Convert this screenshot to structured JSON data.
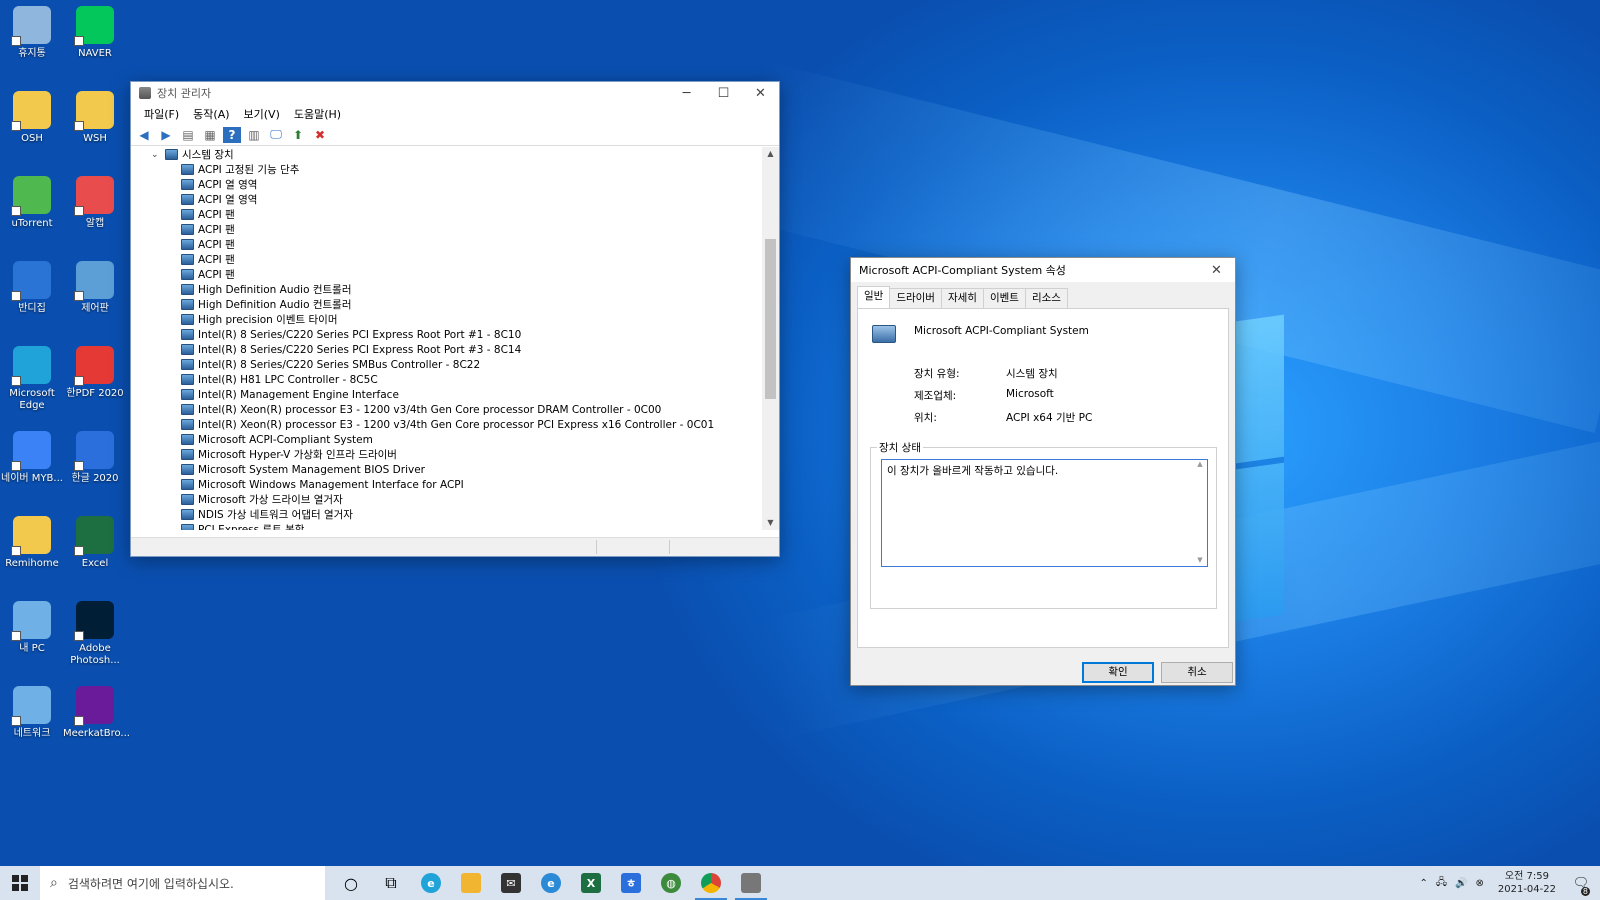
{
  "desktop": {
    "icons": [
      {
        "label": "휴지통",
        "icon": "recycle-bin-icon",
        "color": "#8fb7dd"
      },
      {
        "label": "NAVER",
        "icon": "naver-icon",
        "color": "#03c75a"
      },
      {
        "label": "OSH",
        "icon": "folder-icon",
        "color": "#f2c94c"
      },
      {
        "label": "WSH",
        "icon": "folder-icon",
        "color": "#f2c94c"
      },
      {
        "label": "uTorrent",
        "icon": "utorrent-icon",
        "color": "#4fb84f"
      },
      {
        "label": "알캡",
        "icon": "alcapture-icon",
        "color": "#e84c4c"
      },
      {
        "label": "반디집",
        "icon": "bandizip-icon",
        "color": "#2a74d6"
      },
      {
        "label": "제어판",
        "icon": "control-panel-icon",
        "color": "#5c9fd6"
      },
      {
        "label": "Microsoft Edge",
        "icon": "edge-icon",
        "color": "#1fa3d8"
      },
      {
        "label": "한PDF 2020",
        "icon": "hanpdf-icon",
        "color": "#e53935"
      },
      {
        "label": "네이버 MYB...",
        "icon": "naver-myb-icon",
        "color": "#3b82f6"
      },
      {
        "label": "한글 2020",
        "icon": "hangul-icon",
        "color": "#2a6fdb"
      },
      {
        "label": "Remihome",
        "icon": "remihome-icon",
        "color": "#f2c94c"
      },
      {
        "label": "Excel",
        "icon": "excel-icon",
        "color": "#1d6f42"
      },
      {
        "label": "내 PC",
        "icon": "this-pc-icon",
        "color": "#6fb0e6"
      },
      {
        "label": "Adobe Photosh...",
        "icon": "photoshop-icon",
        "color": "#001e36"
      },
      {
        "label": "네트워크",
        "icon": "network-icon",
        "color": "#6fb0e6"
      },
      {
        "label": "MeerkatBro...",
        "icon": "meerkat-icon",
        "color": "#6a1b9a"
      }
    ]
  },
  "devmgr": {
    "title": "장치 관리자",
    "menu": [
      "파일(F)",
      "동작(A)",
      "보기(V)",
      "도움말(H)"
    ],
    "category": "시스템 장치",
    "devices": [
      "ACPI 고정된 기능 단추",
      "ACPI 열 영역",
      "ACPI 열 영역",
      "ACPI 팬",
      "ACPI 팬",
      "ACPI 팬",
      "ACPI 팬",
      "ACPI 팬",
      "High Definition Audio 컨트롤러",
      "High Definition Audio 컨트롤러",
      "High precision 이벤트 타이머",
      "Intel(R) 8 Series/C220 Series PCI Express Root Port #1 - 8C10",
      "Intel(R) 8 Series/C220 Series PCI Express Root Port #3 - 8C14",
      "Intel(R) 8 Series/C220 Series SMBus Controller - 8C22",
      "Intel(R) H81 LPC Controller - 8C5C",
      "Intel(R) Management Engine Interface",
      "Intel(R) Xeon(R) processor E3 - 1200 v3/4th Gen Core processor DRAM Controller - 0C00",
      "Intel(R) Xeon(R) processor E3 - 1200 v3/4th Gen Core processor PCI Express x16 Controller - 0C01",
      "Microsoft ACPI-Compliant System",
      "Microsoft Hyper-V 가상화 인프라 드라이버",
      "Microsoft System Management BIOS Driver",
      "Microsoft Windows Management Interface for ACPI",
      "Microsoft 가상 드라이브 열거자",
      "NDIS 가상 네트워크 어댑터 열거자",
      "PCI Express 루트 복합"
    ]
  },
  "props": {
    "title": "Microsoft ACPI-Compliant System 속성",
    "tabs": [
      "일반",
      "드라이버",
      "자세히",
      "이벤트",
      "리소스"
    ],
    "device_name": "Microsoft ACPI-Compliant System",
    "type_label": "장치 유형:",
    "type_value": "시스템 장치",
    "maker_label": "제조업체:",
    "maker_value": "Microsoft",
    "location_label": "위치:",
    "location_value": "ACPI x64 기반 PC",
    "status_group": "장치 상태",
    "status_text": "이 장치가 올바르게 작동하고 있습니다.",
    "ok": "확인",
    "cancel": "취소"
  },
  "taskbar": {
    "search_placeholder": "검색하려면 여기에 입력하십시오.",
    "time_period": "오전 7:59",
    "date": "2021-04-22",
    "notification_count": "8"
  }
}
